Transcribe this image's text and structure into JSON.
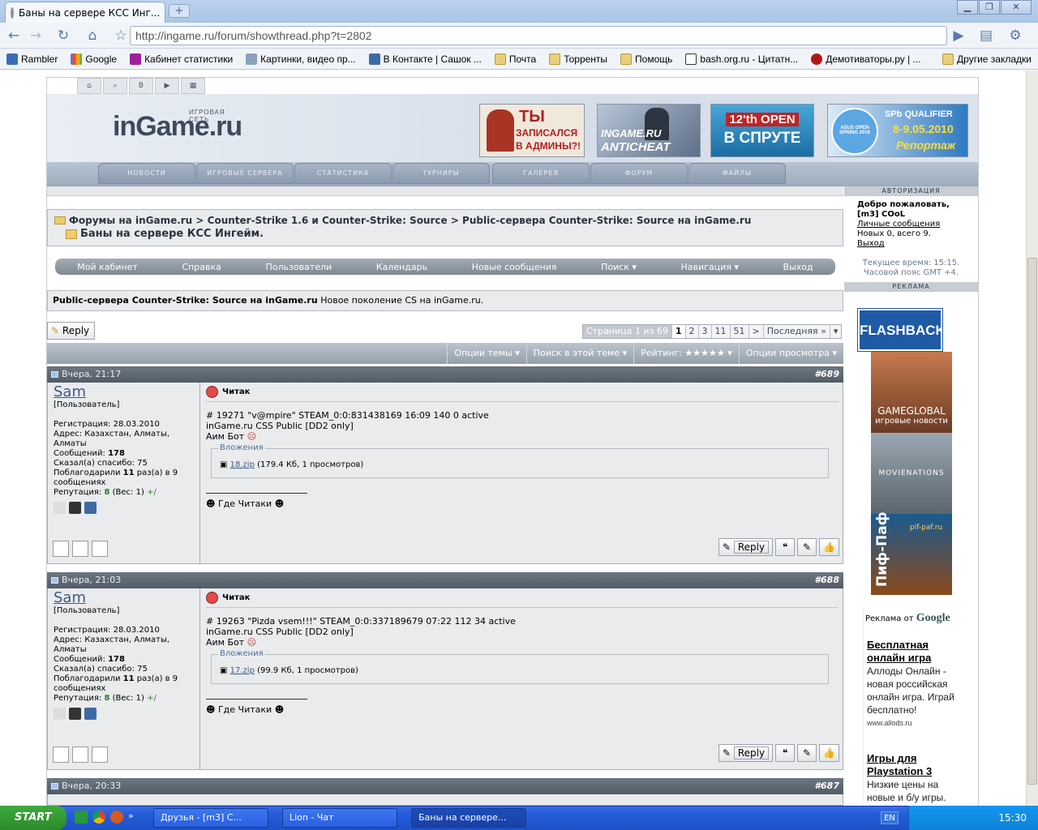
{
  "browser": {
    "tab_title": "Баны на сервере КСС Инг...",
    "url": "http://ingame.ru/forum/showthread.php?t=2802",
    "bookmarks": [
      "Rambler",
      "Google",
      "Кабинет статистики",
      "Картинки, видео пр...",
      "В Контакте | Сашок ...",
      "Почта",
      "Торренты",
      "Помощь",
      "bash.org.ru - Цитатн...",
      "Демотиваторы.ру | ..."
    ],
    "other_bookmarks": "Другие закладки"
  },
  "site": {
    "logo": "inGame.ru",
    "logo_caption": "ИГРОВАЯ СЕТЬ",
    "banners": [
      {
        "line1": "ТЫ",
        "line2": "ЗАПИСАЛСЯ",
        "line3": "В АДМИНЫ?!"
      },
      {
        "line1": "INGAME.RU",
        "line2": "ANTICHEAT"
      },
      {
        "line1": "12'th OPEN",
        "line2": "В СПРУТЕ"
      },
      {
        "line1": "SPb QUALIFIER",
        "line2": "8-9.05.2010",
        "line3": "Репортаж",
        "badge": "ASUS OPEN SPRING 2010"
      }
    ],
    "nav": [
      "НОВОСТИ",
      "ИГРОВЫЕ СЕРВЕРА",
      "СТАТИСТИКА",
      "ТУРНИРЫ",
      "ГАЛЕРЕЯ",
      "ФОРУМ",
      "ФАЙЛЫ"
    ]
  },
  "breadcrumb": {
    "path": "Форумы на inGame.ru > Counter-Strike 1.6 и Counter-Strike: Source > Public-сервера Counter-Strike: Source на inGame.ru",
    "current": "Баны на сервере КСС Ингейм."
  },
  "menu": [
    "Мой кабинет",
    "Справка",
    "Пользователи",
    "Календарь",
    "Новые сообщения",
    "Поиск ▾",
    "Навигация ▾",
    "Выход"
  ],
  "forum": {
    "name": "Public-сервера Counter-Strike: Source на inGame.ru",
    "desc": "Новое поколение CS на inGame.ru."
  },
  "reply_label": "Reply",
  "pagination": [
    "Страница 1 из 69",
    "1",
    "2",
    "3",
    "11",
    "51",
    ">",
    "Последняя »"
  ],
  "options": [
    "Опции темы ▾",
    "Поиск в этой теме ▾",
    "Рейтинг: ★★★★★ ▾",
    "Опции просмотра ▾"
  ],
  "sidebar": {
    "auth_header": "АВТОРИЗАЦИЯ",
    "welcome": "Добро пожаловать,",
    "user": "[m3] COoL",
    "pm_link": "Личные сообщения",
    "pm_counts": "Новых 0, всего 9.",
    "logout": "Выход",
    "time": "Текущее время: 15:15.",
    "tz": "Часовой пояс GMT +4.",
    "ad_header": "РЕКЛАМА",
    "flashback": "FLASHBACK",
    "gameglobal": "GAMEGLOBAL",
    "gameglobal_sub": "игровые новости",
    "movienations": "MOVIENATIONS",
    "pifpaf": "Пиф-Паф",
    "pifpaf_url": "pif-paf.ru",
    "google_label": "Реклама от",
    "google": "Google",
    "ads": [
      {
        "title": "Бесплатная онлайн игра",
        "text": "Аллоды Онлайн - новая российская онлайн игра. Играй бесплатно!",
        "url": "www.allods.ru"
      },
      {
        "title": "Игры для Playstation 3",
        "text": "Низкие цены на новые и б/у игры."
      }
    ]
  },
  "posts": [
    {
      "date": "Вчера, 21:17",
      "num": "#689",
      "user": "Sam",
      "role": "[Пользователь]",
      "reg": "Регистрация: 28.03.2010",
      "addr": "Адрес: Казахстан, Алматы, Алматы",
      "msgs_label": "Сообщений:",
      "msgs": "178",
      "thanks": "Сказал(а) спасибо: 75",
      "thanked_pre": "Поблагодарили",
      "thanked": "11",
      "thanked_post": "раз(а) в 9 сообщениях",
      "rep_label": "Репутация:",
      "rep": "8",
      "rep_weight": "(Вес: 1)",
      "title": "Читак",
      "line1": "# 19271 \"v@mpire\" STEAM_0:0:831438169 16:09 140 0 active",
      "line2": "inGame.ru CSS Public [DD2 only]",
      "line3": "Аим Бот",
      "attach_label": "Вложения",
      "file": "18.zip",
      "file_info": "(179.4 Кб, 1 просмотров)",
      "sig": "Где Читаки"
    },
    {
      "date": "Вчера, 21:03",
      "num": "#688",
      "user": "Sam",
      "role": "[Пользователь]",
      "reg": "Регистрация: 28.03.2010",
      "addr": "Адрес: Казахстан, Алматы, Алматы",
      "msgs_label": "Сообщений:",
      "msgs": "178",
      "thanks": "Сказал(а) спасибо: 75",
      "thanked_pre": "Поблагодарили",
      "thanked": "11",
      "thanked_post": "раз(а) в 9 сообщениях",
      "rep_label": "Репутация:",
      "rep": "8",
      "rep_weight": "(Вес: 1)",
      "title": "Читак",
      "line1": "# 19263 \"Pizda vsem!!!\" STEAM_0:0:337189679 07:22 112 34 active",
      "line2": "inGame.ru CSS Public [DD2 only]",
      "line3": "Аим Бот",
      "attach_label": "Вложения",
      "file": "17.zip",
      "file_info": "(99.9 Кб, 1 просмотров)",
      "sig": "Где Читаки"
    },
    {
      "date": "Вчера, 20:33",
      "num": "#687"
    }
  ],
  "taskbar": {
    "start": "START",
    "tasks": [
      "Друзья - [m3] C...",
      "Lion - Чат",
      "Баны на сервере..."
    ],
    "lang": "EN",
    "clock": "15:30"
  }
}
